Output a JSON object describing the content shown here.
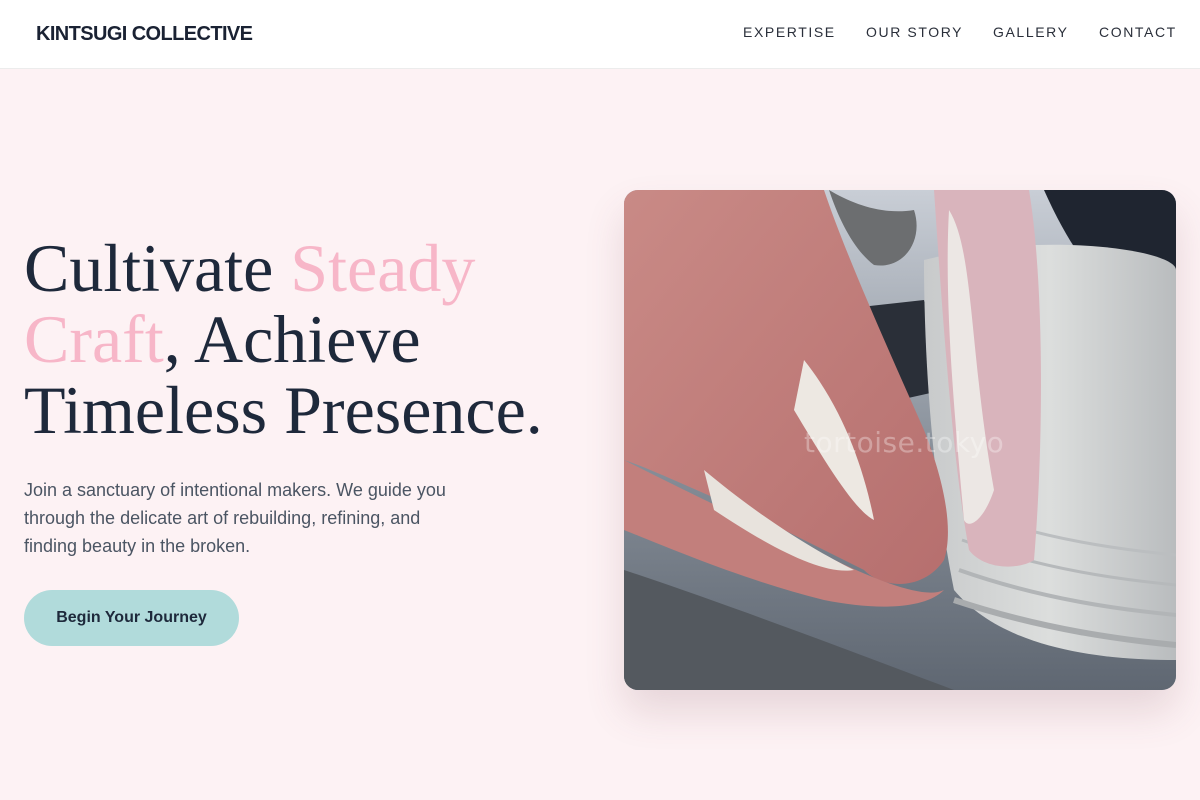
{
  "brand": {
    "name": "KINTSUGI COLLECTIVE"
  },
  "nav": {
    "items": [
      {
        "label": "EXPERTISE"
      },
      {
        "label": "OUR STORY"
      },
      {
        "label": "GALLERY"
      },
      {
        "label": "CONTACT"
      }
    ]
  },
  "hero": {
    "title_part1": "Cultivate ",
    "title_accent1": "Steady",
    "title_accent2": "Craft",
    "title_part2": ", Achieve Timeless Presence.",
    "subtitle": "Join a sanctuary of intentional makers. We guide you through the delicate art of rebuilding, refining, and finding beauty in the broken.",
    "cta_label": "Begin Your Journey",
    "image": {
      "subject": "hands shaping clay on a pottery wheel",
      "watermark": "tortoise.tokyo"
    }
  },
  "colors": {
    "background": "#fdf2f4",
    "accent_pink": "#f7b6c8",
    "cta_teal": "#b1dbdb",
    "text_dark": "#1e293b"
  }
}
